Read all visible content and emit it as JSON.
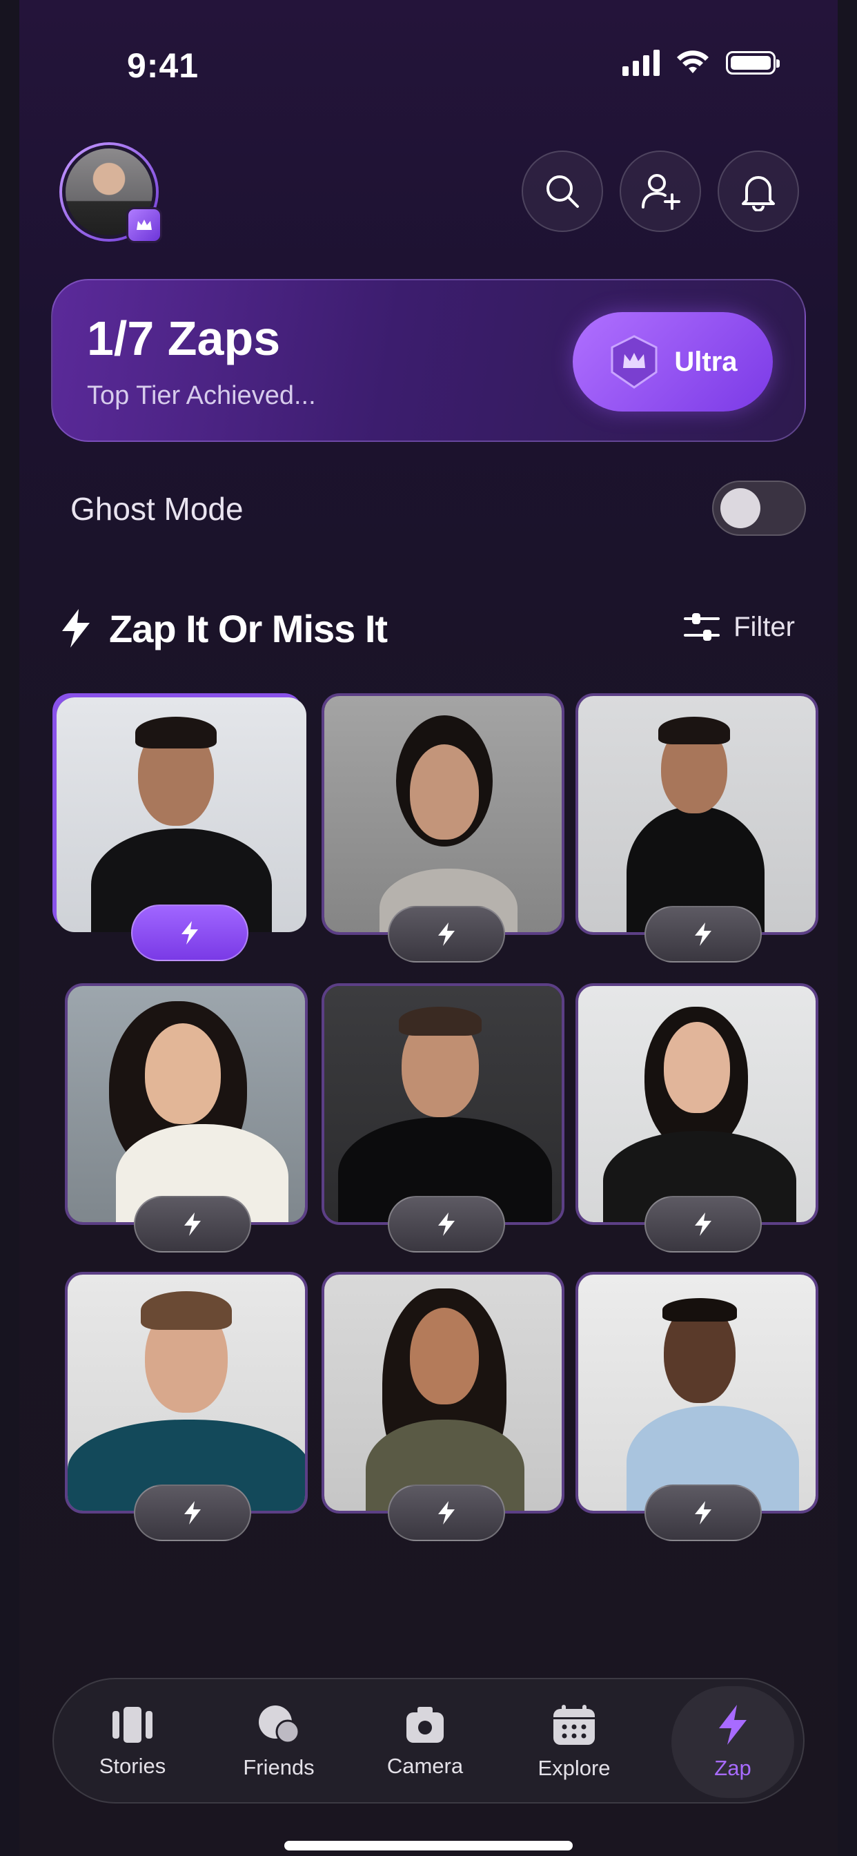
{
  "status": {
    "time": "9:41"
  },
  "header": {
    "search_icon": "search-icon",
    "add_friend_icon": "add-user-icon",
    "notifications_icon": "bell-icon"
  },
  "zap_card": {
    "count": "1/7 Zaps",
    "subtitle": "Top Tier Achieved...",
    "tier_label": "Ultra"
  },
  "ghost_mode": {
    "label": "Ghost Mode",
    "enabled": false
  },
  "section": {
    "title": "Zap It Or Miss It",
    "filter_label": "Filter"
  },
  "people": [
    {
      "zapped": true
    },
    {
      "zapped": false
    },
    {
      "zapped": false
    },
    {
      "zapped": false
    },
    {
      "zapped": false
    },
    {
      "zapped": false
    },
    {
      "zapped": false
    },
    {
      "zapped": false
    },
    {
      "zapped": false
    }
  ],
  "nav": {
    "items": [
      {
        "label": "Stories",
        "icon": "stories-icon"
      },
      {
        "label": "Friends",
        "icon": "chat-icon"
      },
      {
        "label": "Camera",
        "icon": "camera-icon"
      },
      {
        "label": "Explore",
        "icon": "calendar-icon"
      },
      {
        "label": "Zap",
        "icon": "lightning-icon"
      }
    ],
    "active": "Zap"
  },
  "colors": {
    "accent": "#9b5cff",
    "background": "#1a1424"
  }
}
